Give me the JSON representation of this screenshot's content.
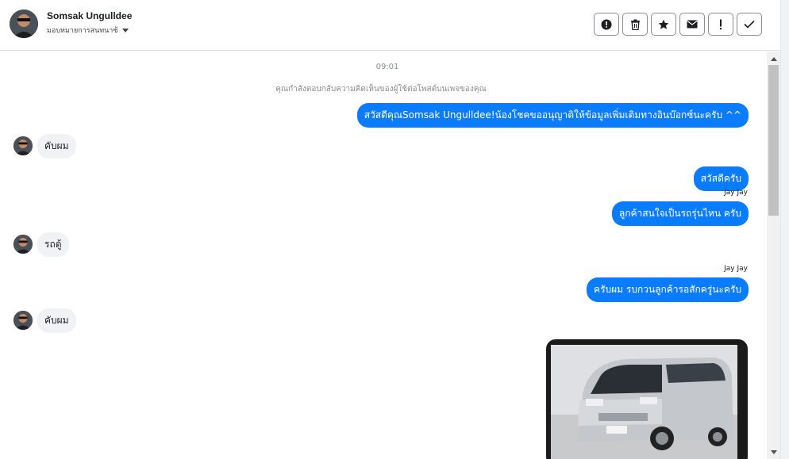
{
  "header": {
    "name": "Somsak Ungulldee",
    "assign_label": "มอบหมายการสนทนาซ้"
  },
  "actions": [
    {
      "icon": "alert-circle-icon"
    },
    {
      "icon": "trash-icon"
    },
    {
      "icon": "star-icon"
    },
    {
      "icon": "envelope-icon"
    },
    {
      "icon": "exclamation-icon"
    },
    {
      "icon": "check-icon"
    }
  ],
  "chat": {
    "time": "09:01",
    "notice": "คุณกำลังตอบกลับความคิดเห็นของผู้ใช้ต่อโพสต์บนเพจของคุณ",
    "messages": [
      {
        "side": "out",
        "text": "สวัสดีคุณSomsak Ungulldee!น้องโชคขออนุญาติให้ข้อมูลเพิ่มเติมทางอินบ๊อกซ์นะครับ ^^"
      },
      {
        "side": "in",
        "text": "คับผม"
      },
      {
        "side": "out",
        "text": "สวัสดีครับ"
      },
      {
        "side": "sender",
        "text": "Jay Jay"
      },
      {
        "side": "out",
        "text": "ลูกค้าสนใจเป็นรถรุ่นไหน ครับ"
      },
      {
        "side": "in",
        "text": "รถตู้"
      },
      {
        "side": "sender",
        "text": "Jay Jay"
      },
      {
        "side": "out",
        "text": "ครับผม รบกวนลูกค้ารอสักครู่นะครับ"
      },
      {
        "side": "in",
        "text": "คับผม"
      }
    ]
  },
  "colors": {
    "outgoing_bubble": "#0a7cff",
    "incoming_bubble": "#f0f2f5"
  }
}
